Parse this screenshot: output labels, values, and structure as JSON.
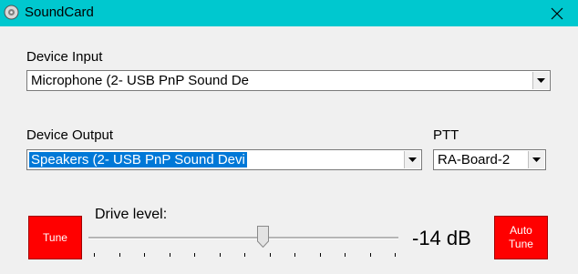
{
  "window": {
    "title": "SoundCard",
    "icon": "soundcard-icon",
    "close_icon": "close-icon"
  },
  "device_input": {
    "label": "Device Input",
    "selected": "Microphone (2- USB PnP Sound De"
  },
  "device_output": {
    "label": "Device Output",
    "selected": "Speakers (2- USB PnP Sound Devi"
  },
  "ptt": {
    "label": "PTT",
    "selected": "RA-Board-2"
  },
  "tune_button": {
    "label": "Tune",
    "color": "#ff0000"
  },
  "drive": {
    "label": "Drive level:",
    "value_text": "-14 dB",
    "level_fraction": 0.56,
    "tick_count": 13
  },
  "auto_tune_button": {
    "label_line1": "Auto",
    "label_line2": "Tune",
    "color": "#ff0000"
  },
  "colors": {
    "titlebar": "#00c8cf",
    "selection": "#0078d7",
    "window_bg": "#f0f0f0"
  }
}
